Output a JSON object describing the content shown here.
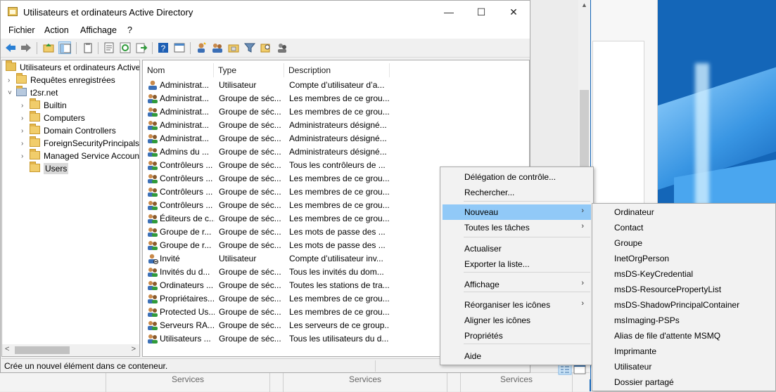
{
  "window": {
    "title": "Utilisateurs et ordinateurs Active Directory",
    "minimize_icon": "minimize-icon",
    "maximize_icon": "maximize-icon",
    "close_icon": "close-icon"
  },
  "menubar": {
    "items": [
      "Fichier",
      "Action",
      "Affichage",
      "?"
    ]
  },
  "tree": {
    "root": "Utilisateurs et ordinateurs Active Directory",
    "items": [
      {
        "label": "Requêtes enregistrées",
        "expander": "›"
      },
      {
        "label": "t2sr.net",
        "expander": "˅"
      },
      {
        "label": "Builtin",
        "expander": "›"
      },
      {
        "label": "Computers",
        "expander": "›"
      },
      {
        "label": "Domain Controllers",
        "expander": "›"
      },
      {
        "label": "ForeignSecurityPrincipals",
        "expander": "›"
      },
      {
        "label": "Managed Service Accounts",
        "expander": "›"
      },
      {
        "label": "Users",
        "expander": ""
      }
    ],
    "scroll_left": "<",
    "scroll_right": ">"
  },
  "list": {
    "columns": [
      "Nom",
      "Type",
      "Description"
    ],
    "rows": [
      {
        "name": "Administrat...",
        "type": "Utilisateur",
        "desc": "Compte d’utilisateur d’a...",
        "icon": "user"
      },
      {
        "name": "Administrat...",
        "type": "Groupe de séc...",
        "desc": "Les membres de ce grou...",
        "icon": "group"
      },
      {
        "name": "Administrat...",
        "type": "Groupe de séc...",
        "desc": "Les membres de ce grou...",
        "icon": "group"
      },
      {
        "name": "Administrat...",
        "type": "Groupe de séc...",
        "desc": "Administrateurs désigné...",
        "icon": "group"
      },
      {
        "name": "Administrat...",
        "type": "Groupe de séc...",
        "desc": "Administrateurs désigné...",
        "icon": "group"
      },
      {
        "name": "Admins du ...",
        "type": "Groupe de séc...",
        "desc": "Administrateurs désigné...",
        "icon": "group"
      },
      {
        "name": "Contrôleurs ...",
        "type": "Groupe de séc...",
        "desc": "Tous les contrôleurs de ...",
        "icon": "group"
      },
      {
        "name": "Contrôleurs ...",
        "type": "Groupe de séc...",
        "desc": "Les membres de ce grou...",
        "icon": "group"
      },
      {
        "name": "Contrôleurs ...",
        "type": "Groupe de séc...",
        "desc": "Les membres de ce grou...",
        "icon": "group"
      },
      {
        "name": "Contrôleurs ...",
        "type": "Groupe de séc...",
        "desc": "Les membres de ce grou...",
        "icon": "group"
      },
      {
        "name": "Éditeurs de c...",
        "type": "Groupe de séc...",
        "desc": "Les membres de ce grou...",
        "icon": "group"
      },
      {
        "name": "Groupe de r...",
        "type": "Groupe de séc...",
        "desc": "Les mots de passe des ...",
        "icon": "group"
      },
      {
        "name": "Groupe de r...",
        "type": "Groupe de séc...",
        "desc": "Les mots de passe des ...",
        "icon": "group"
      },
      {
        "name": "Invité",
        "type": "Utilisateur",
        "desc": "Compte d’utilisateur inv...",
        "icon": "user-disabled"
      },
      {
        "name": "Invités du d...",
        "type": "Groupe de séc...",
        "desc": "Tous les invités du dom...",
        "icon": "group"
      },
      {
        "name": "Ordinateurs ...",
        "type": "Groupe de séc...",
        "desc": "Toutes les stations de tra...",
        "icon": "group"
      },
      {
        "name": "Propriétaires...",
        "type": "Groupe de séc...",
        "desc": "Les membres de ce grou...",
        "icon": "group"
      },
      {
        "name": "Protected Us...",
        "type": "Groupe de séc...",
        "desc": "Les membres de ce grou...",
        "icon": "group"
      },
      {
        "name": "Serveurs RA...",
        "type": "Groupe de séc...",
        "desc": "Les serveurs de ce group...",
        "icon": "group"
      },
      {
        "name": "Utilisateurs ...",
        "type": "Groupe de séc...",
        "desc": "Tous les utilisateurs du d...",
        "icon": "group"
      }
    ]
  },
  "status": {
    "text": "Crée un nouvel élément dans ce conteneur."
  },
  "context_menu": {
    "items": [
      {
        "label": "Délégation de contrôle...",
        "submenu": false
      },
      {
        "label": "Rechercher...",
        "submenu": false
      },
      {
        "label": "Nouveau",
        "submenu": true,
        "highlighted": true
      },
      {
        "label": "Toutes les tâches",
        "submenu": true
      },
      {
        "label": "Actualiser",
        "submenu": false
      },
      {
        "label": "Exporter la liste...",
        "submenu": false
      },
      {
        "label": "Affichage",
        "submenu": true
      },
      {
        "label": "Réorganiser les icônes",
        "submenu": true
      },
      {
        "label": "Aligner les icônes",
        "submenu": false
      },
      {
        "label": "Propriétés",
        "submenu": false
      },
      {
        "label": "Aide",
        "submenu": false
      }
    ],
    "submenu_arrow": "›"
  },
  "new_submenu": {
    "items": [
      "Ordinateur",
      "Contact",
      "Groupe",
      "InetOrgPerson",
      "msDS-KeyCredential",
      "msDS-ResourcePropertyList",
      "msDS-ShadowPrincipalContainer",
      "msImaging-PSPs",
      "Alias de file d'attente MSMQ",
      "Imprimante",
      "Utilisateur",
      "Dossier partagé"
    ]
  },
  "background": {
    "services_label": "Services"
  }
}
